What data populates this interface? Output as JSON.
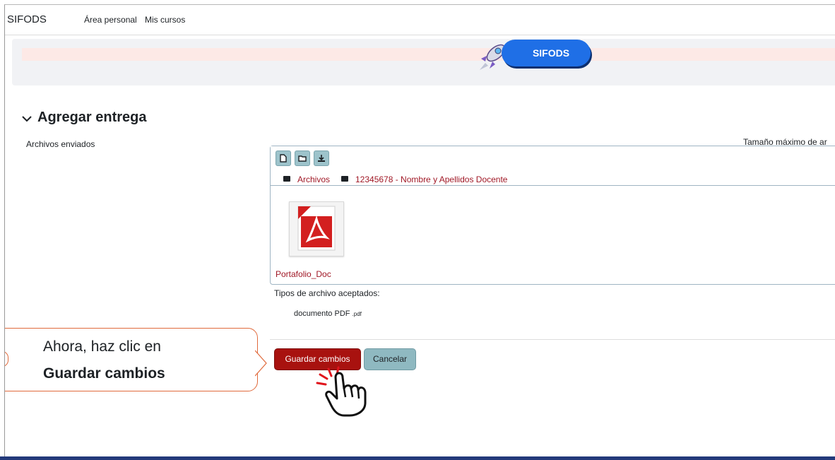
{
  "nav": {
    "brand": "SIFODS",
    "links": [
      "Área personal",
      "Mis cursos"
    ]
  },
  "banner": {
    "pill_text": "SIFODS",
    "icon": "rocket-icon"
  },
  "section": {
    "title": "Agregar entrega",
    "field_label": "Archivos enviados",
    "max_size_label": "Tamaño máximo de ar"
  },
  "filemanager": {
    "toolbar_icons": [
      "add-file-icon",
      "create-folder-icon",
      "download-icon"
    ],
    "breadcrumb": [
      "Archivos",
      "12345678 - Nombre y Apellidos Docente"
    ],
    "file": {
      "name": "Portafolio_Doc",
      "icon": "pdf-file-icon"
    }
  },
  "accepted": {
    "label": "Tipos de archivo aceptados:",
    "type_name": "documento PDF",
    "type_ext": ".pdf"
  },
  "buttons": {
    "save": "Guardar cambios",
    "cancel": "Cancelar"
  },
  "callout": {
    "line1": "Ahora, haz clic en",
    "line2": "Guardar cambios"
  },
  "colors": {
    "primary": "#a8120f",
    "secondary": "#8fb9c1",
    "link": "#a01826",
    "pill": "#1f6fe6",
    "callout_border": "#e06a3c"
  }
}
